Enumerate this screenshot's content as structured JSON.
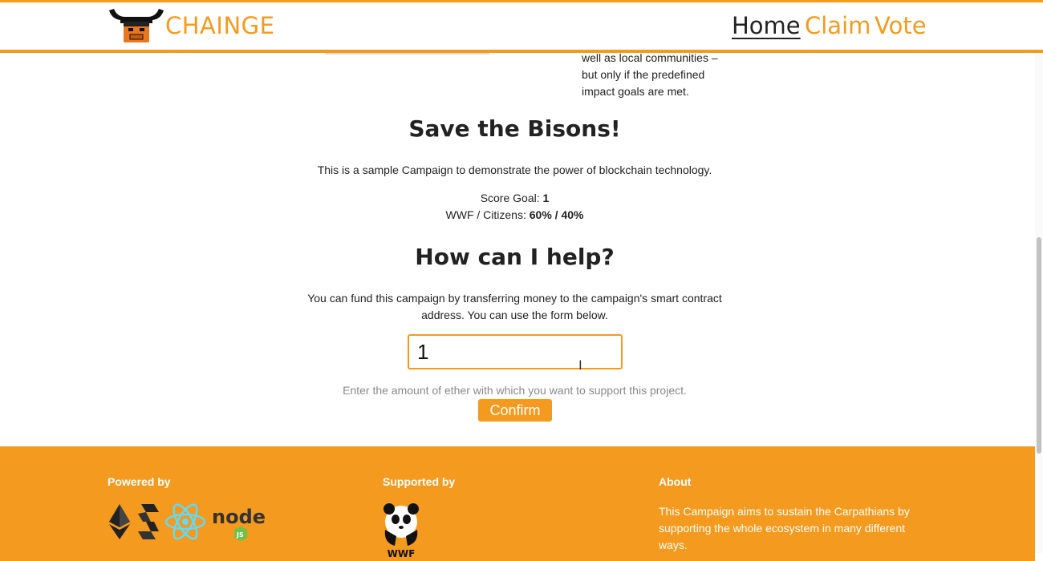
{
  "header": {
    "brand": "CHAINGE",
    "logo_icon": "bull-logo-icon",
    "nav": [
      {
        "label": "Home",
        "active": true
      },
      {
        "label": "Claim",
        "active": false
      },
      {
        "label": "Vote",
        "active": false
      }
    ]
  },
  "intro": {
    "lines": [
      "well as local communities –",
      "but only if the predefined",
      "impact goals are met."
    ]
  },
  "campaign": {
    "title": "Save the Bisons!",
    "description": "This is a sample Campaign to demonstrate the power of blockchain technology.",
    "score_goal_label": "Score Goal: ",
    "score_goal_value": "1",
    "split_label": "WWF / Citizens: ",
    "split_value": "60% / 40%"
  },
  "help": {
    "title": "How can I help?",
    "text_line1": "You can fund this campaign by transferring money to the campaign's smart contract",
    "text_line2": "address. You can use the form below.",
    "amount_value": "1",
    "hint": "Enter the amount of ether with which you want to support this project.",
    "confirm_label": "Confirm"
  },
  "footer": {
    "powered_by": "Powered by",
    "powered_icons": [
      "ethereum-icon",
      "solidity-icon",
      "react-icon",
      "nodejs-icon"
    ],
    "supported_by": "Supported by",
    "supporter_icon": "wwf-panda-icon",
    "about_heading": "About",
    "about_text": "This Campaign aims to sustain the Carpathians by supporting the whole ecosystem in many different ways."
  },
  "colors": {
    "accent": "#f39a1f",
    "text": "#222222",
    "hint": "#8a8a8a"
  }
}
